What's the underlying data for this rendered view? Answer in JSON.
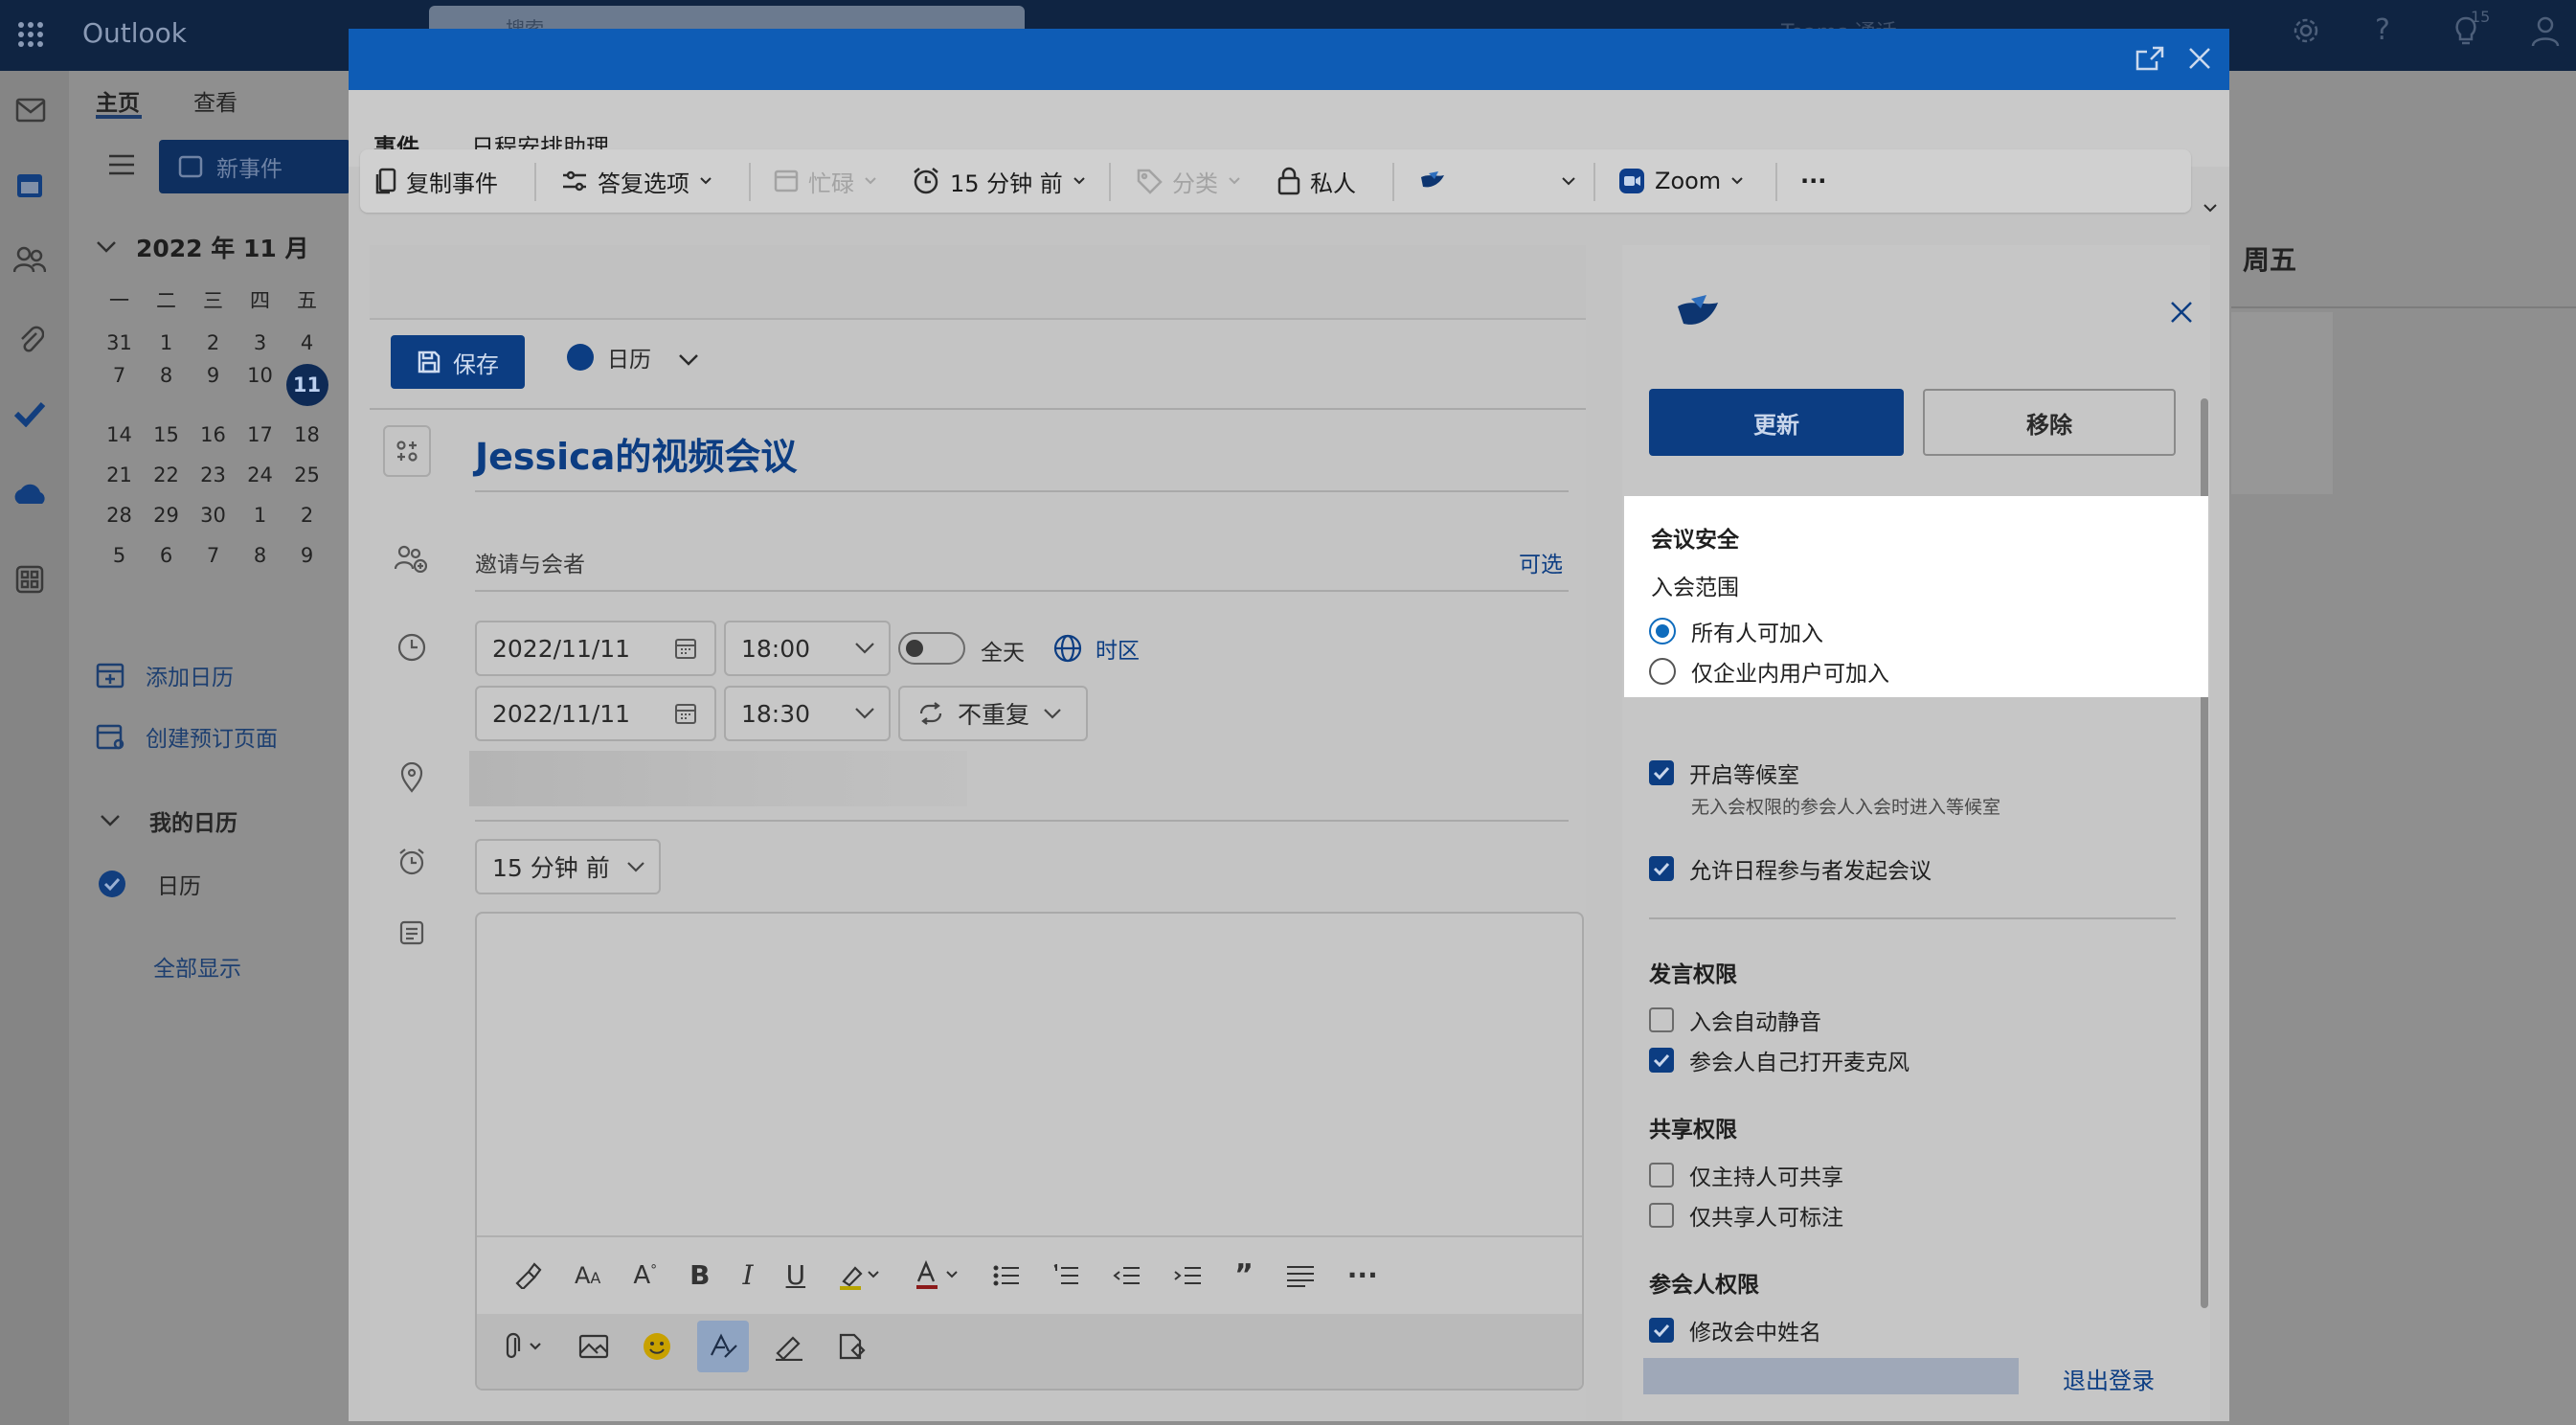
{
  "app": {
    "name": "Outlook",
    "search_placeholder": "搜索",
    "teams_label": "Teams 通话",
    "notification_count": "15"
  },
  "ribbon_tabs": [
    "主页",
    "查看"
  ],
  "new_event_label": "新事件",
  "calendar": {
    "month_title": "2022 年 11 月",
    "weekdays": [
      "一",
      "二",
      "三",
      "四",
      "五"
    ],
    "weeks": [
      [
        "31",
        "1",
        "2",
        "3",
        "4"
      ],
      [
        "7",
        "8",
        "9",
        "10",
        "11"
      ],
      [
        "14",
        "15",
        "16",
        "17",
        "18"
      ],
      [
        "21",
        "22",
        "23",
        "24",
        "25"
      ],
      [
        "28",
        "29",
        "30",
        "1",
        "2"
      ],
      [
        "5",
        "6",
        "7",
        "8",
        "9"
      ]
    ],
    "today": "11"
  },
  "left_links": {
    "add_calendar": "添加日历",
    "create_booking": "创建预订页面",
    "my_calendars": "我的日历",
    "calendar_item": "日历",
    "show_all": "全部显示"
  },
  "right_bg": {
    "weekday": "周五"
  },
  "dialog": {
    "tabs": [
      "事件",
      "日程安排助理"
    ],
    "ribbon": {
      "copy_event": "复制事件",
      "reply_options": "答复选项",
      "busy": "忙碌",
      "reminder": "15 分钟 前",
      "category": "分类",
      "private": "私人",
      "zoom": "Zoom",
      "more": "···"
    },
    "form": {
      "save": "保存",
      "calendar_name": "日历",
      "title": "Jessica的视频会议",
      "invite_placeholder": "邀请与会者",
      "optional": "可选",
      "start_date": "2022/11/11",
      "start_time": "18:00",
      "all_day": "全天",
      "timezone": "时区",
      "end_date": "2022/11/11",
      "end_time": "18:30",
      "repeat": "不重复",
      "reminder": "15 分钟 前"
    },
    "pane": {
      "update": "更新",
      "remove": "移除",
      "security_title": "会议安全",
      "join_scope": "入会范围",
      "scope_all": "所有人可加入",
      "scope_internal": "仅企业内用户可加入",
      "waiting_room": "开启等候室",
      "waiting_room_desc": "无入会权限的参会人入会时进入等候室",
      "allow_start": "允许日程参与者发起会议",
      "speak_title": "发言权限",
      "auto_mute": "入会自动静音",
      "self_unmute": "参会人自己打开麦克风",
      "share_title": "共享权限",
      "host_share": "仅主持人可共享",
      "sharer_annotate": "仅共享人可标注",
      "attendee_title": "参会人权限",
      "rename": "修改会中姓名",
      "logout": "退出登录"
    }
  }
}
